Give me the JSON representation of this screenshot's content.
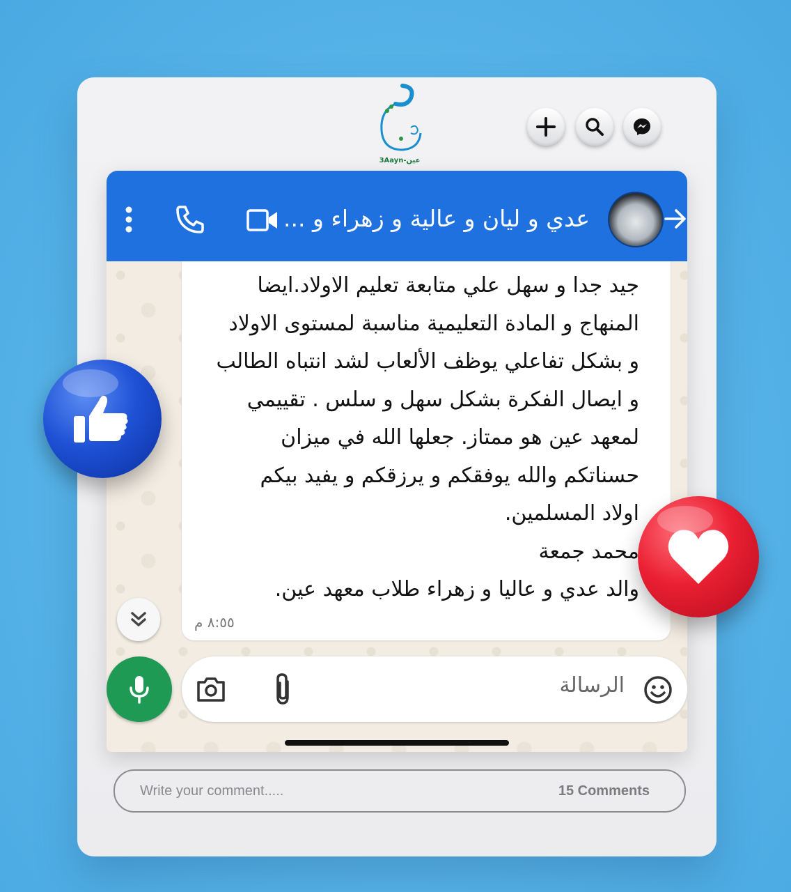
{
  "logo": {
    "caption": "3Aayn-عين"
  },
  "top_actions": {
    "add_icon": "plus-icon",
    "search_icon": "search-icon",
    "messenger_icon": "messenger-icon"
  },
  "chat": {
    "contact_name": "عدي و ليان و عالية و زهراء و ...",
    "message_lines": [
      "جيد جدا و سهل علي متابعة تعليم الاولاد.ايضا",
      "المنهاج و المادة التعليمية مناسبة لمستوى الاولاد",
      "و بشكل تفاعلي يوظف الألعاب لشد انتباه الطالب",
      "و ايصال الفكرة بشكل سهل و سلس . تقييمي",
      "لمعهد عين هو ممتاز.  جعلها الله في ميزان",
      "حسناتكم والله يوفقكم و يرزقكم و يفيد بيكم",
      "اولاد المسلمين.",
      "محمد جمعة",
      "والد عدي و عاليا و زهراء  طلاب معهد عين."
    ],
    "time": "٨:٥٥ م",
    "input_placeholder": "الرسالة"
  },
  "comments": {
    "placeholder": "Write your comment.....",
    "count_label": "15 Comments"
  },
  "colors": {
    "header_blue": "#1f71e0",
    "mic_green": "#1e9a55",
    "like_blue": "#1f52d6",
    "heart_red": "#ea1f33"
  }
}
